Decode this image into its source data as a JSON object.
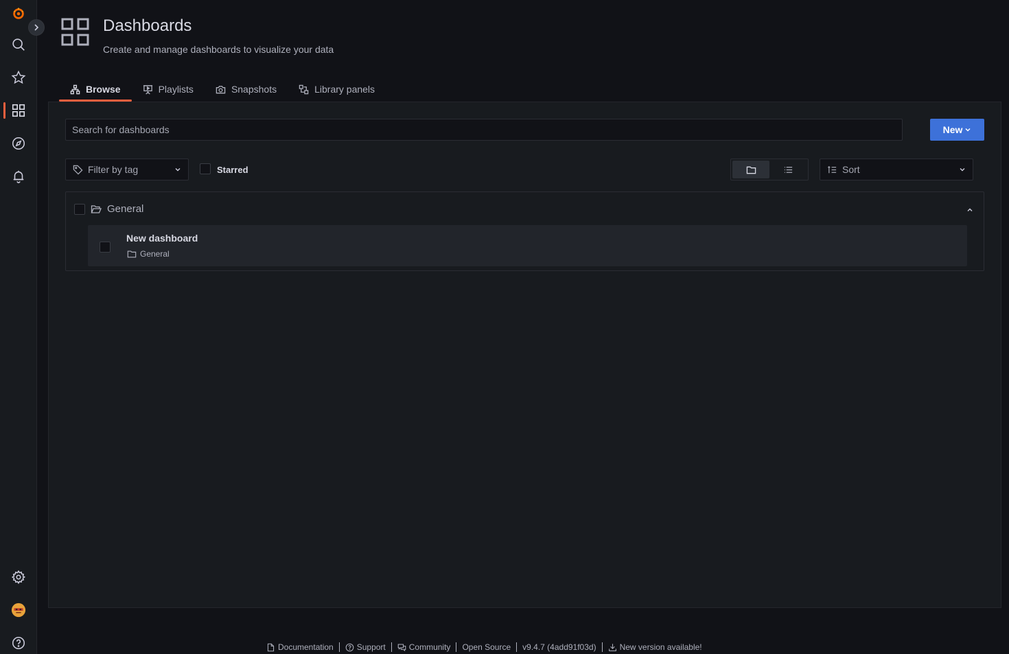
{
  "header": {
    "title": "Dashboards",
    "subtitle": "Create and manage dashboards to visualize your data"
  },
  "tabs": [
    {
      "label": "Browse",
      "active": true
    },
    {
      "label": "Playlists"
    },
    {
      "label": "Snapshots"
    },
    {
      "label": "Library panels"
    }
  ],
  "search": {
    "placeholder": "Search for dashboards"
  },
  "new_button": {
    "label": "New"
  },
  "filters": {
    "tag_placeholder": "Filter by tag",
    "starred_label": "Starred",
    "sort_label": "Sort"
  },
  "folder": {
    "name": "General",
    "items": [
      {
        "title": "New dashboard",
        "folder": "General"
      }
    ]
  },
  "footer": {
    "documentation": "Documentation",
    "support": "Support",
    "community": "Community",
    "open_source": "Open Source",
    "version": "v9.4.7 (4add91f03d)",
    "new_version": "New version available!"
  },
  "colors": {
    "accent": "#f55f3e",
    "primary_button": "#3d71d9",
    "background": "#111217",
    "panel": "#181b1f"
  }
}
